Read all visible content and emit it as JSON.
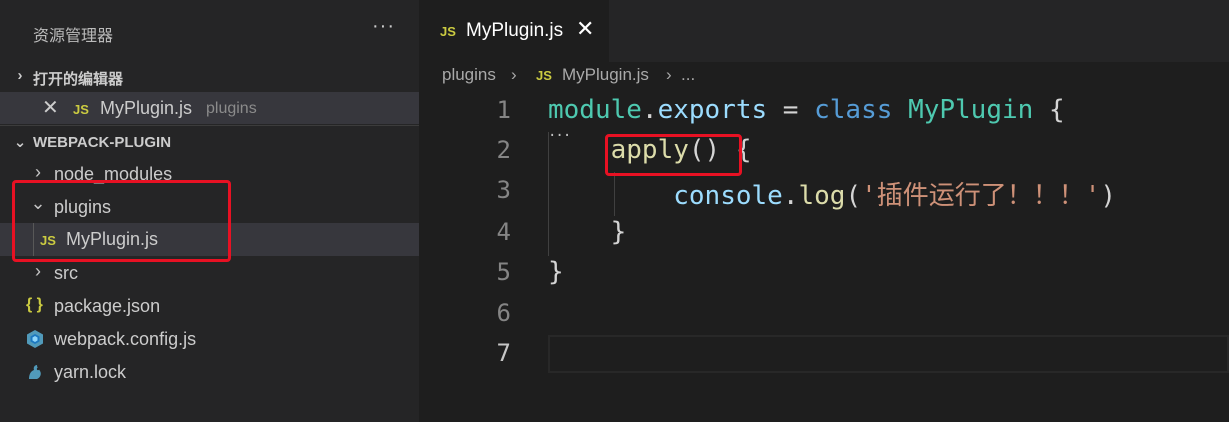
{
  "sidebar": {
    "title": "资源管理器",
    "more_label": "···",
    "open_editors": {
      "header": "打开的编辑器",
      "items": [
        {
          "icon": "JS",
          "name": "MyPlugin.js",
          "folder": "plugins"
        }
      ]
    },
    "project": {
      "header": "WEBPACK-PLUGIN",
      "items": [
        {
          "name": "node_modules",
          "type": "folder",
          "expanded": false
        },
        {
          "name": "plugins",
          "type": "folder",
          "expanded": true
        },
        {
          "name": "MyPlugin.js",
          "type": "file",
          "icon": "JS"
        },
        {
          "name": "src",
          "type": "folder",
          "expanded": false
        },
        {
          "name": "package.json",
          "type": "file",
          "icon": "{ }"
        },
        {
          "name": "webpack.config.js",
          "type": "file",
          "icon": "webpack-icon"
        },
        {
          "name": "yarn.lock",
          "type": "file",
          "icon": "yarn-icon"
        }
      ]
    }
  },
  "editor": {
    "tab": {
      "icon": "JS",
      "label": "MyPlugin.js",
      "close": "✕"
    },
    "breadcrumb": [
      "plugins",
      "JS",
      "MyPlugin.js",
      "..."
    ],
    "line_numbers": [
      "1",
      "2",
      "3",
      "4",
      "5",
      "6",
      "7"
    ],
    "code": {
      "l1": [
        "module",
        ".",
        "exports",
        " = ",
        "class",
        " ",
        "MyPlugin",
        " {"
      ],
      "l2": [
        "    ",
        "apply",
        "()",
        " {"
      ],
      "l3": [
        "        ",
        "console",
        ".",
        "log",
        "(",
        "'插件运行了！！！'",
        ")"
      ],
      "l4": [
        "    }"
      ],
      "l5": [
        "}"
      ]
    }
  },
  "colors": {
    "highlight_box": "#e81123",
    "js_icon": "#cbcb41",
    "background": "#1e1e1e",
    "sidebar": "#252526"
  }
}
